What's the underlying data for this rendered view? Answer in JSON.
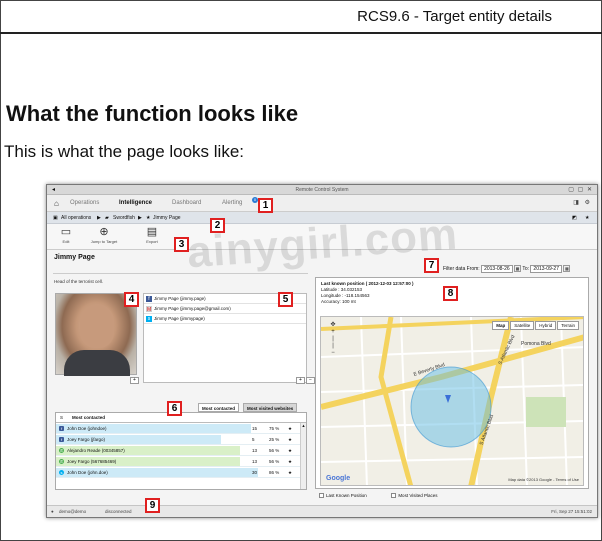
{
  "document": {
    "running_header": "RCS9.6 - Target entity details",
    "section_heading": "What the function looks like",
    "body_text": "This is what the page looks like:"
  },
  "screenshot": {
    "app_title": "Remote Control System",
    "tabs": [
      {
        "label": "Operations"
      },
      {
        "label": "Intelligence"
      },
      {
        "label": "Dashboard"
      },
      {
        "label": "Alerting"
      }
    ],
    "alert_badge": "0",
    "breadcrumb": {
      "items": [
        "All operations",
        "Swordfish",
        "Jimmy Page"
      ],
      "separator": "▶"
    },
    "toolbar": [
      {
        "label": "Edit",
        "icon": "edit-icon"
      },
      {
        "label": "Jump to Target",
        "icon": "target-icon"
      },
      {
        "label": "Export",
        "icon": "export-icon"
      }
    ],
    "entity": {
      "name": "Jimmy Page",
      "description": "Head of the terrorist cell."
    },
    "contacts": [
      {
        "service": "facebook",
        "handle": "Jimmy Page (jimmy.page)"
      },
      {
        "service": "gmail",
        "handle": "Jimmy Page (jimmy.page@gmail.com)"
      },
      {
        "service": "skype",
        "handle": "Jimmy Page (jimmypage)"
      }
    ],
    "contact_tabs": {
      "active": "Most contacted",
      "inactive": "Most visited websites"
    },
    "most_contacted": {
      "columns": [
        "S",
        "Most contacted"
      ],
      "rows": [
        {
          "service": "facebook",
          "name": "John Doe (johndoe)",
          "count": "15",
          "percent": "75 %",
          "color": "#cdeaf7"
        },
        {
          "service": "facebook",
          "name": "Joey Fargo (jfargo)",
          "count": "5",
          "percent": "25 %",
          "color": "#cdeaf7"
        },
        {
          "service": "whatsapp",
          "name": "Alejandro Reade (00345857)",
          "count": "13",
          "percent": "56 %",
          "color": "#d9f0c8"
        },
        {
          "service": "whatsapp",
          "name": "Joey Fargo (567685469)",
          "count": "13",
          "percent": "56 %",
          "color": "#d9f0c8"
        },
        {
          "service": "skype",
          "name": "John Doe (john.doe)",
          "count": "30",
          "percent": "86 %",
          "color": "#cdeaf7"
        }
      ]
    },
    "filter": {
      "label": "Filter data",
      "from_label": "From:",
      "from": "2013-08-26",
      "to_label": "To:",
      "to": "2013-09-27"
    },
    "position": {
      "title": "Last known position ( 2012-12-03 12:57:00 )",
      "latitude": "Latitude : 34.032153",
      "longitude": "Longitude : -118.154563",
      "accuracy": "Accuracy: 100 mt"
    },
    "map": {
      "types": [
        "Map",
        "Satellite",
        "Hybrid",
        "Terrain"
      ],
      "selected_type": "Map",
      "streets": [
        "Pomona Blvd",
        "E Beverly Blvd",
        "S Atlantic Blvd",
        "S Atlantic Blvd"
      ],
      "logo": "Google",
      "credit": "Map data ©2013 Google - Terms of Use"
    },
    "legend": [
      "Last Known Position",
      "Most Visited Places"
    ],
    "status": {
      "user": "demo@demo",
      "connection": "disconnected",
      "datetime": "Fri, Sep 27    15:51:02"
    },
    "callouts": [
      "1",
      "2",
      "3",
      "4",
      "5",
      "6",
      "7",
      "8",
      "9"
    ],
    "watermark": "ainygirl.com"
  }
}
